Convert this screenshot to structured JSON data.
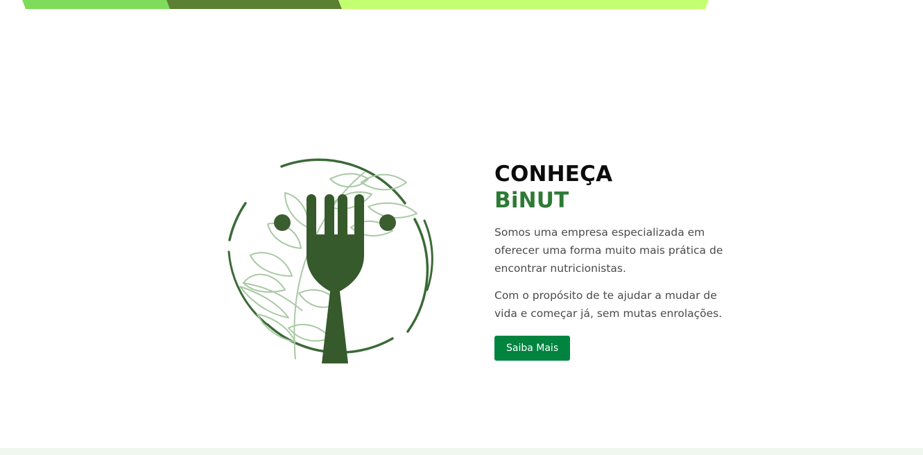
{
  "about": {
    "heading_line1": "CONHEÇA",
    "heading_line2": "BiNUT",
    "paragraph1": "Somos uma empresa especializada em oferecer uma forma muito mais prática de encontrar nutricionistas.",
    "paragraph2": "Com o propósito de te ajudar a mudar de vida e começar já, sem mutas enrolações.",
    "button_label": "Saiba Mais"
  },
  "logo": {
    "icon": "fork-with-leaves-icon"
  },
  "colors": {
    "band_light_green": "#7edc5a",
    "band_dark_green": "#5b8034",
    "band_lime": "#c4ff71",
    "brand_green": "#2e7a35",
    "logo_dark_green": "#3b5e30",
    "leaf_green": "#a9c9a4",
    "button_green": "#00843f",
    "footer_tint": "#eef8ec"
  }
}
